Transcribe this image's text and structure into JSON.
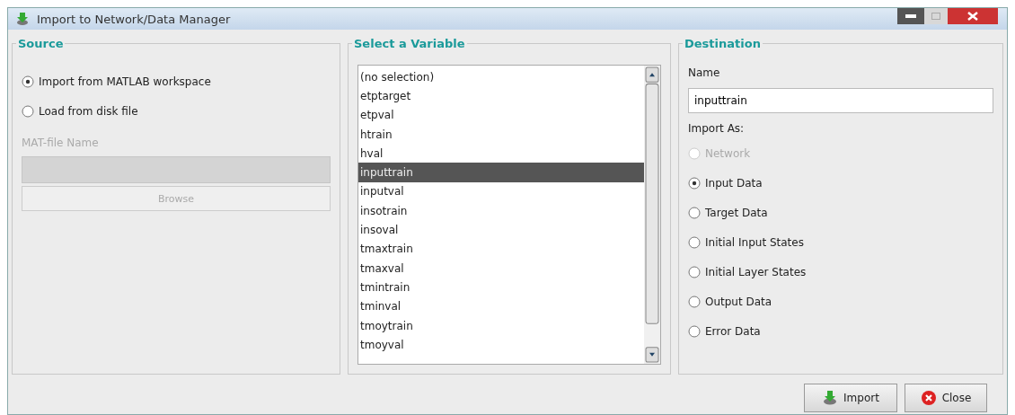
{
  "window": {
    "title": "Import to Network/Data Manager"
  },
  "source": {
    "title": "Source",
    "options": [
      {
        "label": "Import from MATLAB workspace",
        "selected": true
      },
      {
        "label": "Load from disk file",
        "selected": false
      }
    ],
    "file_label": "MAT-file Name",
    "file_disabled": true,
    "browse": "Browse"
  },
  "variables": {
    "title": "Select a Variable",
    "items": [
      {
        "label": "(no selection)",
        "selected": false
      },
      {
        "label": "etptarget",
        "selected": false
      },
      {
        "label": "etpval",
        "selected": false
      },
      {
        "label": "htrain",
        "selected": false
      },
      {
        "label": "hval",
        "selected": false
      },
      {
        "label": "inputtrain",
        "selected": true
      },
      {
        "label": "inputval",
        "selected": false
      },
      {
        "label": "insotrain",
        "selected": false
      },
      {
        "label": "insoval",
        "selected": false
      },
      {
        "label": "tmaxtrain",
        "selected": false
      },
      {
        "label": "tmaxval",
        "selected": false
      },
      {
        "label": "tmintrain",
        "selected": false
      },
      {
        "label": "tminval",
        "selected": false
      },
      {
        "label": "tmoytrain",
        "selected": false
      },
      {
        "label": "tmoyval",
        "selected": false
      }
    ]
  },
  "destination": {
    "title": "Destination",
    "name_label": "Name",
    "name_value": "inputtrain",
    "import_as_label": "Import As:",
    "options": [
      {
        "label": "Network",
        "selected": false,
        "disabled": true
      },
      {
        "label": "Input Data",
        "selected": true,
        "disabled": false
      },
      {
        "label": "Target Data",
        "selected": false,
        "disabled": false
      },
      {
        "label": "Initial Input States",
        "selected": false,
        "disabled": false
      },
      {
        "label": "Initial Layer States",
        "selected": false,
        "disabled": false
      },
      {
        "label": "Output Data",
        "selected": false,
        "disabled": false
      },
      {
        "label": "Error Data",
        "selected": false,
        "disabled": false
      }
    ]
  },
  "buttons": [
    {
      "kind": "import",
      "label": "Import"
    },
    {
      "kind": "close",
      "label": "Close"
    }
  ]
}
